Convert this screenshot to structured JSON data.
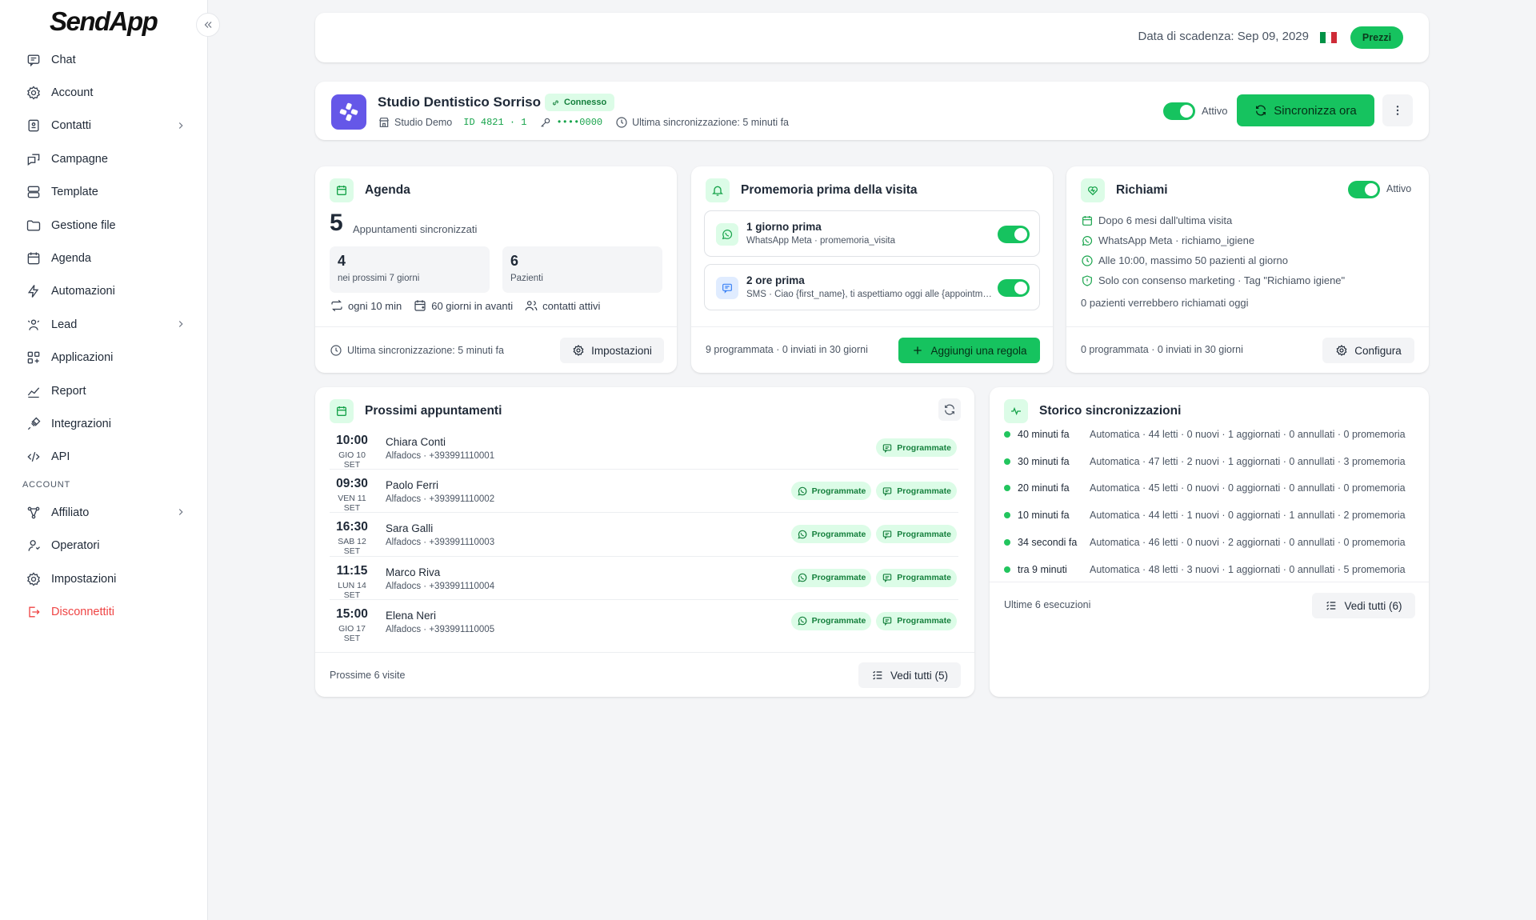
{
  "sidebar": {
    "logo": "SendApp",
    "items": [
      {
        "label": "Chat",
        "icon": "chat-icon"
      },
      {
        "label": "Account",
        "icon": "gear-icon"
      },
      {
        "label": "Contatti",
        "icon": "contacts-icon"
      },
      {
        "label": "Campagne",
        "icon": "campaign-icon"
      },
      {
        "label": "Template",
        "icon": "template-icon"
      },
      {
        "label": "Gestione file",
        "icon": "folder-icon"
      },
      {
        "label": "Agenda",
        "icon": "calendar-icon"
      },
      {
        "label": "Automazioni",
        "icon": "bolt-icon"
      },
      {
        "label": "Lead",
        "icon": "lead-icon"
      },
      {
        "label": "Applicazioni",
        "icon": "apps-icon"
      },
      {
        "label": "Report",
        "icon": "chart-icon"
      },
      {
        "label": "Integrazioni",
        "icon": "plug-icon"
      },
      {
        "label": "API",
        "icon": "code-icon"
      }
    ],
    "section_label": "ACCOUNT",
    "account_items": [
      {
        "label": "Affiliato",
        "icon": "affiliate-icon"
      },
      {
        "label": "Operatori",
        "icon": "user-icon"
      },
      {
        "label": "Impostazioni",
        "icon": "gear-icon"
      },
      {
        "label": "Disconnettiti",
        "icon": "logout-icon"
      }
    ]
  },
  "topbar": {
    "due_date": "Data di scadenza: Sep 09, 2029",
    "price_button": "Prezzi",
    "flag": "italy-flag-icon"
  },
  "integration": {
    "name": "Studio Dentistico Sorriso",
    "status_badge": "Connesso",
    "studio": "Studio Demo",
    "id": "ID 4821 · 1",
    "key": "••••0000",
    "last_sync": "Ultima sincronizzazione: 5 minuti fa",
    "toggle_label": "Attivo",
    "sync_button": "Sincronizza ora"
  },
  "agenda": {
    "title": "Agenda",
    "total": "5",
    "total_label": "Appuntamenti sincronizzati",
    "stats": [
      {
        "value": "4",
        "label": "nei prossimi 7 giorni"
      },
      {
        "value": "6",
        "label": "Pazienti"
      }
    ],
    "meta": [
      "ogni 10 min",
      "60 giorni in avanti",
      "contatti attivi"
    ],
    "footer": "Ultima sincronizzazione: 5 minuti fa",
    "button": "Impostazioni"
  },
  "promemoria": {
    "title": "Promemoria prima della visita",
    "rules": [
      {
        "title": "1 giorno prima",
        "subtitle": "WhatsApp Meta · promemoria_visita",
        "enabled": true
      },
      {
        "title": "2 ore prima",
        "subtitle": "SMS · Ciao {first_name}, ti aspettiamo oggi alle {appointment_time}",
        "enabled": true
      }
    ],
    "footer": "9 programmata · 0 inviati in 30 giorni",
    "button": "Aggiungi una regola"
  },
  "richiami": {
    "title": "Richiami",
    "toggle_label": "Attivo",
    "items": [
      "Dopo 6 mesi dall'ultima visita",
      "WhatsApp Meta · richiamo_igiene",
      "Alle 10:00, massimo 50 pazienti al giorno",
      "Solo con consenso marketing · Tag \"Richiamo igiene\""
    ],
    "note": "0 pazienti verrebbero richiamati oggi",
    "footer": "0 programmata · 0 inviati in 30 giorni",
    "button": "Configura"
  },
  "appointments": {
    "title": "Prossimi appuntamenti",
    "rows": [
      {
        "time": "10:00",
        "date": "GIO 10 SET",
        "name": "Chiara Conti",
        "sub": "Alfadocs · +393991110001",
        "chips": [
          "Programmate"
        ],
        "whatsapp": false
      },
      {
        "time": "09:30",
        "date": "VEN 11 SET",
        "name": "Paolo Ferri",
        "sub": "Alfadocs · +393991110002",
        "chips": [
          "Programmate",
          "Programmate"
        ],
        "whatsapp": true
      },
      {
        "time": "16:30",
        "date": "SAB 12 SET",
        "name": "Sara Galli",
        "sub": "Alfadocs · +393991110003",
        "chips": [
          "Programmate",
          "Programmate"
        ],
        "whatsapp": true
      },
      {
        "time": "11:15",
        "date": "LUN 14 SET",
        "name": "Marco Riva",
        "sub": "Alfadocs · +393991110004",
        "chips": [
          "Programmate",
          "Programmate"
        ],
        "whatsapp": true
      },
      {
        "time": "15:00",
        "date": "GIO 17 SET",
        "name": "Elena Neri",
        "sub": "Alfadocs · +393991110005",
        "chips": [
          "Programmate",
          "Programmate"
        ],
        "whatsapp": true
      }
    ],
    "footer": "Prossime 6 visite",
    "button": "Vedi tutti (5)"
  },
  "history": {
    "title": "Storico sincronizzazioni",
    "rows": [
      {
        "ago": "40 minuti fa",
        "desc": "Automatica · 44 letti · 0 nuovi · 1 aggiornati · 0 annullati · 0 promemoria"
      },
      {
        "ago": "30 minuti fa",
        "desc": "Automatica · 47 letti · 2 nuovi · 1 aggiornati · 0 annullati · 3 promemoria"
      },
      {
        "ago": "20 minuti fa",
        "desc": "Automatica · 45 letti · 0 nuovi · 0 aggiornati · 0 annullati · 0 promemoria"
      },
      {
        "ago": "10 minuti fa",
        "desc": "Automatica · 44 letti · 1 nuovi · 0 aggiornati · 1 annullati · 2 promemoria"
      },
      {
        "ago": "34 secondi fa",
        "desc": "Automatica · 46 letti · 0 nuovi · 2 aggiornati · 0 annullati · 0 promemoria"
      },
      {
        "ago": "tra 9 minuti",
        "desc": "Automatica · 48 letti · 3 nuovi · 1 aggiornati · 0 annullati · 5 promemoria"
      }
    ],
    "footer": "Ultime 6 esecuzioni",
    "button": "Vedi tutti (6)"
  },
  "colors": {
    "accent": "#16c35f",
    "accent_soft": "#dcfce7",
    "danger": "#ef4444",
    "brand_purple": "#6557e8"
  }
}
